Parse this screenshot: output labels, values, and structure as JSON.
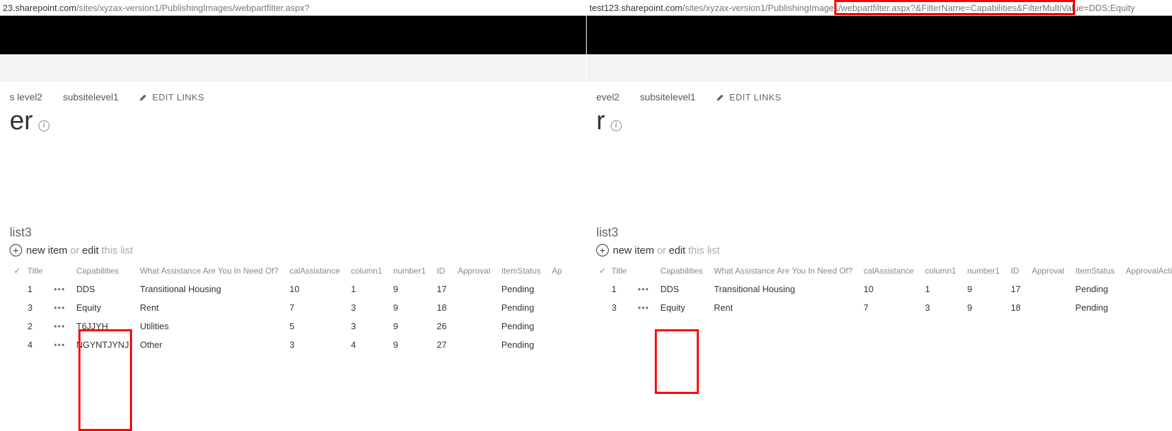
{
  "left": {
    "url_host": "23.sharepoint.com",
    "url_path": "/sites/xyzax-version1/PublishingImages/webpartfilter.aspx?",
    "nav": {
      "crumb1": "s level2",
      "crumb2": "subsitelevel1",
      "edit": "EDIT LINKS"
    },
    "title_fragment": "er",
    "listname": "list3",
    "newitem": {
      "new": "new item",
      "or": "or",
      "edit": "edit",
      "rest": "this list"
    },
    "columns": [
      "",
      "Title",
      "",
      "Capabilities",
      "What Assistance Are You In Need Of?",
      "calAssistance",
      "column1",
      "number1",
      "ID",
      "Approval",
      "ItemStatus",
      "Ap"
    ],
    "rows": [
      {
        "title": "1",
        "cap": "DDS",
        "what": "Transitional Housing",
        "cal": "10",
        "col1": "1",
        "num1": "9",
        "id": "17",
        "approval": "",
        "status": "Pending"
      },
      {
        "title": "3",
        "cap": "Equity",
        "what": "Rent",
        "cal": "7",
        "col1": "3",
        "num1": "9",
        "id": "18",
        "approval": "",
        "status": "Pending"
      },
      {
        "title": "2",
        "cap": "T6JJYH",
        "what": "Utilities",
        "cal": "5",
        "col1": "3",
        "num1": "9",
        "id": "26",
        "approval": "",
        "status": "Pending"
      },
      {
        "title": "4",
        "cap": "NGYNTJYNJ",
        "what": "Other",
        "cal": "3",
        "col1": "4",
        "num1": "9",
        "id": "27",
        "approval": "",
        "status": "Pending"
      }
    ]
  },
  "right": {
    "url_host": "test123.sharepoint.com",
    "url_path_before": "/sites/xyzax-version1/PublishingImages/webpartfilter",
    "url_path_highlight": ".aspx?&FilterName=Capabilities&FilterMultiValue=DDS;Equity",
    "nav": {
      "crumb1": "evel2",
      "crumb2": "subsitelevel1",
      "edit": "EDIT LINKS"
    },
    "title_fragment": "r",
    "listname": "list3",
    "newitem": {
      "new": "new item",
      "or": "or",
      "edit": "edit",
      "rest": "this list"
    },
    "columns": [
      "",
      "Title",
      "",
      "Capabilities",
      "What Assistance Are You In Need Of?",
      "calAssistance",
      "column1",
      "number1",
      "ID",
      "Approval",
      "ItemStatus",
      "ApprovalActionBy"
    ],
    "rows": [
      {
        "title": "1",
        "cap": "DDS",
        "what": "Transitional Housing",
        "cal": "10",
        "col1": "1",
        "num1": "9",
        "id": "17",
        "approval": "",
        "status": "Pending"
      },
      {
        "title": "3",
        "cap": "Equity",
        "what": "Rent",
        "cal": "7",
        "col1": "3",
        "num1": "9",
        "id": "18",
        "approval": "",
        "status": "Pending"
      }
    ]
  },
  "icons": {
    "dots": "•••",
    "check": "✓",
    "plus": "+"
  }
}
